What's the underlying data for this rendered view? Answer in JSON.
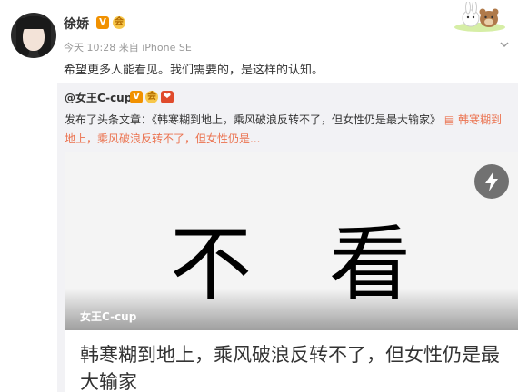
{
  "post": {
    "username": "徐娇",
    "timestamp": "今天 10:28",
    "source_prefix": "来自",
    "source": "iPhone SE",
    "text": "希望更多人能看见。我们需要的，是这样的认知。",
    "badge_v": "V",
    "badge_vip": "会",
    "icons": [
      "avatar",
      "verified-v-icon",
      "vip-icon",
      "sticker-decoration",
      "chevron-down-icon"
    ]
  },
  "repost": {
    "username": "@女王C-cup",
    "badge_v": "V",
    "badge_vip": "会",
    "badge_flag": "❤",
    "text_prefix": "发布了头条文章：《韩寒糊到地上，乘风破浪反转不了，但女性仍是最大输家》",
    "link_icon": "▤",
    "link_text_1": "韩寒糊到",
    "link_text_2": "地上，乘风破浪反转不了，但女性仍是...",
    "card": {
      "cover_char_1": "不",
      "cover_char_2": "看",
      "author": "女王C-cup",
      "title": "韩寒糊到地上，乘风破浪反转不了，但女性仍是最大输家",
      "flash_icon": "flash-icon"
    }
  },
  "colors": {
    "link": "#eb7350",
    "badge_v": "#f19100",
    "repost_bg": "#f2f2f5"
  }
}
